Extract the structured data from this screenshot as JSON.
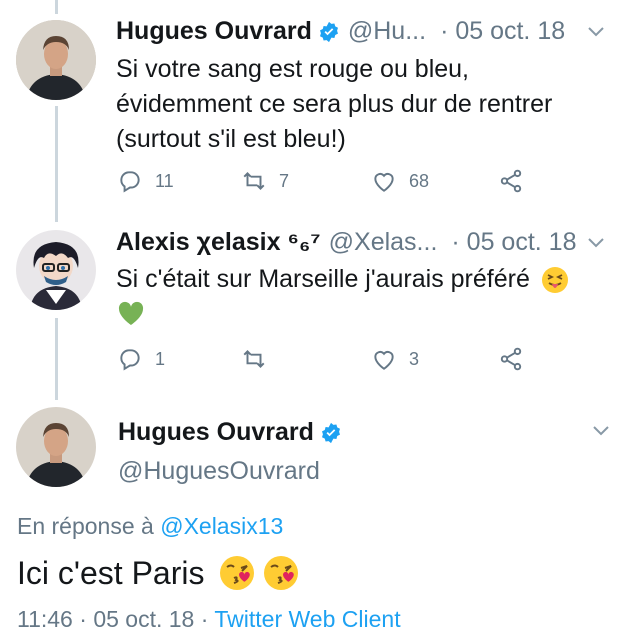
{
  "tweets": [
    {
      "name": "Hugues Ouvrard",
      "handle": "@Hu...",
      "date": "· 05 oct. 18",
      "lines": [
        "Si votre sang est rouge ou bleu,",
        "évidemment ce sera plus dur de rentrer",
        "(surtout s'il est bleu!)"
      ],
      "replies": "11",
      "retweets": "7",
      "likes": "68"
    },
    {
      "name": "Alexis χelasix ⁶₆⁷",
      "handle": "@Xelas...",
      "date": "· 05 oct. 18",
      "text": "Si c'était sur Marseille j'aurais préféré",
      "replies": "1",
      "retweets": "",
      "likes": "3"
    }
  ],
  "main_tweet": {
    "name": "Hugues Ouvrard",
    "handle": "@HuguesOuvrard",
    "reply_prefix": "En réponse à",
    "reply_to": "@Xelasix13",
    "text": "Ici c'est Paris",
    "time": "11:46",
    "date": "05 oct. 18",
    "separator": "·",
    "client": "Twitter Web Client"
  },
  "icons": [
    "verified-icon",
    "chevron-down-icon",
    "reply-icon",
    "retweet-icon",
    "like-icon",
    "share-icon",
    "squinting-tongue-emoji",
    "green-heart-emoji",
    "kiss-emoji"
  ],
  "colors": {
    "link": "#1da1f2",
    "muted": "#657786",
    "verified": "#1da1f2",
    "text": "#14171a"
  }
}
